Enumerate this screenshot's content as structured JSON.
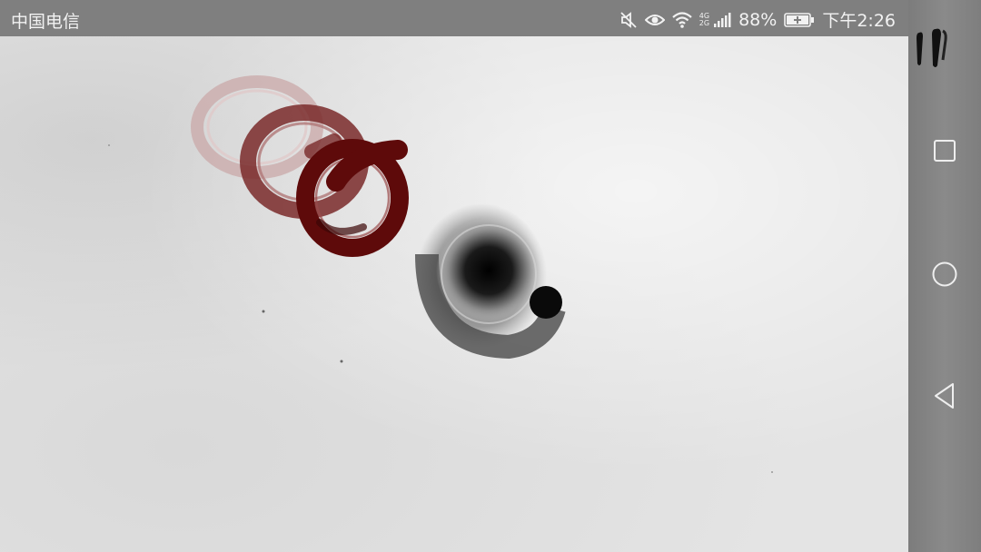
{
  "status_bar": {
    "carrier": "中国电信",
    "network_top": "4G",
    "network_bottom": "2G",
    "battery_percent": "88%",
    "time": "下午2:26",
    "icons": [
      "mute-icon",
      "eye-comfort-icon",
      "wifi-icon",
      "signal-icon",
      "battery-charging-icon"
    ]
  },
  "game": {
    "colors": {
      "paper": "#e4e4e4",
      "ink_black": "#0a0a0a",
      "ink_red_dark": "#5e0a0a",
      "ink_red_mid": "#7a2a2a",
      "ink_red_light": "#c9a8a8"
    },
    "pieces": [
      "red-ink-ring-faded",
      "red-ink-ring-medium",
      "red-ink-ring-dark",
      "black-ink-orb"
    ],
    "pause_icon": "brush-pause-icon"
  },
  "nav_bar": {
    "buttons": [
      "recent-apps-icon",
      "home-icon",
      "back-icon"
    ]
  }
}
